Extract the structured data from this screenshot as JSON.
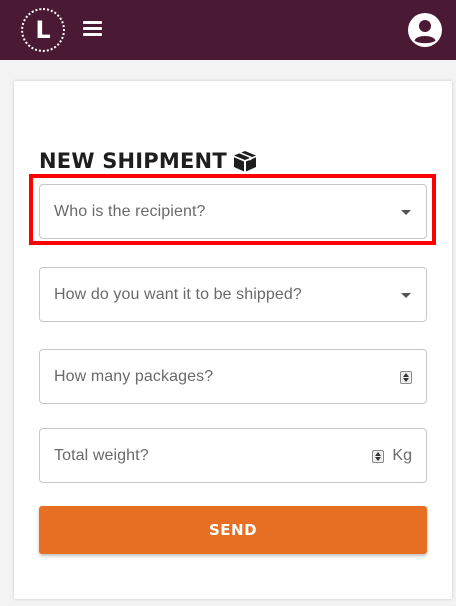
{
  "header": {
    "logo_letter": "L",
    "menu_icon": "hamburger-menu-icon",
    "user_icon": "user-account-icon",
    "background_color": "#4a1933"
  },
  "form": {
    "title": "NEW SHIPMENT",
    "title_icon": "package-box-icon",
    "recipient_placeholder": "Who is the recipient?",
    "shipping_method_placeholder": "How do you want it to be shipped?",
    "packages_placeholder": "How many packages?",
    "weight_placeholder": "Total weight?",
    "weight_unit": "Kg",
    "send_label": "SEND",
    "send_button_color": "#e66f23",
    "highlight_color": "#ff0000"
  }
}
